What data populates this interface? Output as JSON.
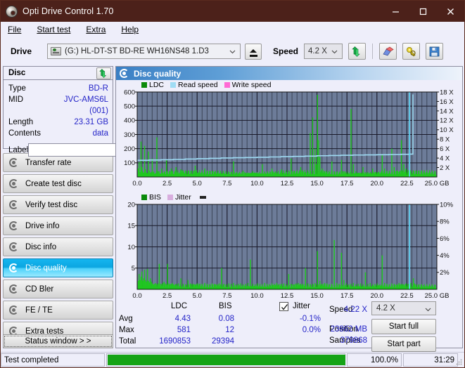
{
  "window": {
    "title": "Opti Drive Control 1.70",
    "icon": "disc-icon",
    "minimize": "minimize-icon",
    "maximize": "maximize-icon",
    "close": "close-icon"
  },
  "menu": {
    "items": [
      "File",
      "Start test",
      "Extra",
      "Help"
    ]
  },
  "toolbar": {
    "drive_label": "Drive",
    "drive_value": "(G:)  HL-DT-ST BD-RE  WH16NS48 1.D3",
    "eject": "eject-icon",
    "speed_label": "Speed",
    "speed_value": "4.2 X",
    "refresh": "refresh-icon",
    "erase": "eraser-icon",
    "key": "key-icon",
    "save": "save-icon"
  },
  "disc_panel": {
    "header": "Disc",
    "refresh_icon": "refresh-icon",
    "rows": [
      {
        "key": "Type",
        "value": "BD-R"
      },
      {
        "key": "MID",
        "value": "JVC-AMS6L (001)"
      },
      {
        "key": "Length",
        "value": "23.31 GB"
      },
      {
        "key": "Contents",
        "value": "data"
      }
    ],
    "label_key": "Label",
    "label_value": "",
    "label_placeholder": ""
  },
  "sidebar": {
    "items": [
      {
        "label": "Transfer rate",
        "selected": false
      },
      {
        "label": "Create test disc",
        "selected": false
      },
      {
        "label": "Verify test disc",
        "selected": false
      },
      {
        "label": "Drive info",
        "selected": false
      },
      {
        "label": "Disc info",
        "selected": false
      },
      {
        "label": "Disc quality",
        "selected": true
      },
      {
        "label": "CD Bler",
        "selected": false
      },
      {
        "label": "FE / TE",
        "selected": false
      },
      {
        "label": "Extra tests",
        "selected": false
      }
    ],
    "status_window": "Status window > >"
  },
  "content": {
    "title": "Disc quality",
    "title_icon": "disc-quality-icon"
  },
  "stats": {
    "col_ldc": "LDC",
    "col_bis": "BIS",
    "row_avg": "Avg",
    "row_max": "Max",
    "row_total": "Total",
    "ldc_avg": "4.43",
    "ldc_max": "581",
    "ldc_total": "1690853",
    "bis_avg": "0.08",
    "bis_max": "12",
    "bis_total": "29394",
    "jitter_label": "Jitter",
    "jitter_checked": true,
    "jitter_avg": "-0.1%",
    "jitter_max": "0.0%",
    "speed_label": "Speed",
    "speed_value": "4.22 X",
    "position_label": "Position",
    "position_value": "23862 MB",
    "samples_label": "Samples",
    "samples_value": "379868",
    "speed_select": "4.2 X",
    "start_full": "Start full",
    "start_part": "Start part"
  },
  "statusbar": {
    "message": "Test completed",
    "progress_percent": 100,
    "percent_text": "100.0%",
    "elapsed": "31:29"
  },
  "colors": {
    "ldc": "#1ec81e",
    "bis": "#1ec81e",
    "read_speed": "#9fdcf4",
    "write_speed": "#ff6ad5",
    "jitter": "#d8aede",
    "plot_bg": "#6d7c99",
    "grid": "#1a1a2a",
    "accent_blue": "#2424c8",
    "titlebar": "#4c211a",
    "progress": "#16a316"
  },
  "chart_data": [
    {
      "type": "bar",
      "name": "top-chart",
      "title": "",
      "xlabel": "25.0 GB",
      "ylabel": "",
      "y2label": "",
      "xlim": [
        0,
        25
      ],
      "ylim": [
        0,
        600
      ],
      "y2lim": [
        0,
        18
      ],
      "grid": true,
      "legend": [
        {
          "label": "LDC",
          "color": "#1ec81e"
        },
        {
          "label": "Read speed",
          "color": "#9fdcf4"
        },
        {
          "label": "Write speed",
          "color": "#ff6ad5"
        }
      ],
      "xticks": [
        "0.0",
        "2.5",
        "5.0",
        "7.5",
        "10.0",
        "12.5",
        "15.0",
        "17.5",
        "20.0",
        "22.5",
        "25.0 GB"
      ],
      "yticks": [
        "100",
        "200",
        "300",
        "400",
        "500",
        "600"
      ],
      "y2ticks": [
        "2 X",
        "4 X",
        "6 X",
        "8 X",
        "10 X",
        "12 X",
        "14 X",
        "16 X",
        "18 X"
      ],
      "series": [
        {
          "name": "LDC",
          "color": "#1ec81e",
          "kind": "bars",
          "x": [
            0.05,
            0.12,
            0.2,
            0.28,
            0.35,
            0.42,
            0.5,
            0.58,
            0.66,
            0.74,
            0.82,
            0.9,
            0.98,
            1.06,
            1.14,
            1.22,
            1.3,
            1.4,
            1.5,
            1.6,
            1.7,
            1.8,
            1.9,
            2.0,
            2.1,
            2.2,
            2.3,
            2.4,
            2.5,
            2.6,
            2.7,
            2.8,
            2.9,
            3.0,
            3.1,
            3.2,
            3.3,
            3.4,
            3.5,
            3.6,
            3.7,
            3.8,
            3.9,
            4.0,
            4.2,
            4.4,
            4.6,
            4.8,
            5.0,
            5.2,
            5.4,
            5.6,
            5.8,
            6.0,
            6.2,
            6.4,
            6.6,
            6.8,
            7.0,
            7.2,
            7.4,
            7.6,
            7.8,
            8.0,
            8.2,
            8.4,
            8.6,
            8.8,
            9.0,
            9.2,
            9.4,
            9.6,
            9.8,
            10.0,
            10.2,
            10.4,
            10.6,
            10.8,
            11.0,
            11.2,
            11.4,
            11.6,
            11.8,
            12.0,
            12.2,
            12.4,
            12.6,
            12.8,
            13.0,
            13.2,
            13.4,
            13.6,
            13.8,
            14.0,
            14.2,
            14.4,
            14.6,
            14.8,
            14.9,
            15.0,
            15.1,
            15.2,
            15.4,
            15.6,
            15.8,
            16.0,
            16.2,
            16.4,
            16.6,
            16.8,
            17.0,
            17.2,
            17.4,
            17.6,
            17.8,
            18.0,
            18.2,
            18.4,
            18.6,
            18.8,
            19.0,
            19.2,
            19.4,
            19.6,
            19.8,
            20.0,
            20.2,
            20.4,
            20.6,
            20.8,
            21.0,
            21.2,
            21.4,
            21.6,
            21.8,
            22.0,
            22.2,
            22.4,
            22.6,
            22.8,
            23.0,
            23.1
          ],
          "values": [
            60,
            105,
            35,
            250,
            70,
            40,
            30,
            220,
            55,
            30,
            25,
            180,
            45,
            28,
            20,
            130,
            35,
            22,
            20,
            280,
            40,
            25,
            22,
            60,
            30,
            24,
            20,
            120,
            30,
            22,
            20,
            60,
            28,
            20,
            18,
            70,
            30,
            22,
            20,
            55,
            45,
            30,
            26,
            40,
            28,
            25,
            22,
            80,
            28,
            22,
            20,
            60,
            28,
            22,
            20,
            35,
            26,
            22,
            20,
            30,
            25,
            22,
            20,
            110,
            30,
            25,
            22,
            45,
            28,
            24,
            20,
            40,
            30,
            25,
            22,
            90,
            35,
            28,
            25,
            60,
            30,
            26,
            22,
            55,
            30,
            26,
            22,
            130,
            35,
            28,
            25,
            70,
            40,
            30,
            28,
            310,
            420,
            200,
            90,
            580,
            260,
            140,
            60,
            40,
            35,
            30,
            110,
            40,
            30,
            26,
            120,
            40,
            30,
            26,
            480,
            90,
            40,
            30,
            26,
            70,
            35,
            30,
            26,
            60,
            35,
            28,
            26,
            160,
            60,
            40,
            30,
            200,
            70,
            45,
            35,
            260,
            90,
            60,
            45,
            30
          ]
        },
        {
          "name": "Read speed",
          "color": "#9fdcf4",
          "kind": "line",
          "axis": "right",
          "x": [
            0.0,
            1.0,
            2.0,
            3.0,
            4.0,
            5.0,
            6.0,
            7.0,
            8.0,
            9.0,
            10.0,
            11.0,
            12.0,
            13.0,
            14.0,
            15.0,
            16.0,
            17.0,
            18.0,
            19.0,
            20.0,
            21.0,
            22.0,
            22.7,
            23.0
          ],
          "values": [
            3.55,
            3.6,
            3.65,
            3.72,
            3.8,
            3.88,
            3.95,
            4.02,
            4.08,
            4.12,
            4.18,
            4.24,
            4.3,
            4.36,
            4.42,
            4.5,
            4.55,
            4.6,
            4.65,
            4.68,
            4.72,
            4.76,
            4.8,
            4.85,
            17.5
          ]
        },
        {
          "name": "Write speed",
          "color": "#ff6ad5",
          "kind": "line",
          "axis": "right",
          "x": [],
          "values": []
        }
      ]
    },
    {
      "type": "bar",
      "name": "bottom-chart",
      "title": "",
      "xlabel": "25.0 GB",
      "ylabel": "",
      "xlim": [
        0,
        25
      ],
      "ylim": [
        0,
        20
      ],
      "y2lim": [
        0,
        10
      ],
      "grid": true,
      "legend": [
        {
          "label": "BIS",
          "color": "#1ec81e"
        },
        {
          "label": "Jitter",
          "color": "#d8aede"
        }
      ],
      "xticks": [
        "0.0",
        "2.5",
        "5.0",
        "7.5",
        "10.0",
        "12.5",
        "15.0",
        "17.5",
        "20.0",
        "22.5",
        "25.0 GB"
      ],
      "yticks": [
        "5",
        "10",
        "15",
        "20"
      ],
      "y2ticks": [
        "2%",
        "4%",
        "6%",
        "8%",
        "10%"
      ],
      "series": [
        {
          "name": "BIS",
          "color": "#1ec81e",
          "kind": "bars",
          "x": [
            0.05,
            0.12,
            0.2,
            0.28,
            0.35,
            0.42,
            0.5,
            0.58,
            0.66,
            0.74,
            0.82,
            0.9,
            0.98,
            1.06,
            1.14,
            1.22,
            1.3,
            1.4,
            1.5,
            1.6,
            1.7,
            1.8,
            1.9,
            2.0,
            2.1,
            2.2,
            2.3,
            2.4,
            2.5,
            2.6,
            2.7,
            2.8,
            2.9,
            3.0,
            3.2,
            3.4,
            3.6,
            3.8,
            4.0,
            4.2,
            4.4,
            4.6,
            4.8,
            5.0,
            5.2,
            5.4,
            5.6,
            5.8,
            6.0,
            6.2,
            6.4,
            6.6,
            6.8,
            7.0,
            7.2,
            7.4,
            7.6,
            7.8,
            8.0,
            8.2,
            8.4,
            8.6,
            8.8,
            9.0,
            9.2,
            9.4,
            9.6,
            9.8,
            10.0,
            10.2,
            10.4,
            10.6,
            10.8,
            11.0,
            11.2,
            11.4,
            11.6,
            11.8,
            12.0,
            12.2,
            12.4,
            12.6,
            12.8,
            13.0,
            13.2,
            13.4,
            13.6,
            13.8,
            14.0,
            14.2,
            14.4,
            14.6,
            14.8,
            15.0,
            15.2,
            15.4,
            15.6,
            15.8,
            16.0,
            16.2,
            16.4,
            16.6,
            16.8,
            17.0,
            17.2,
            17.4,
            17.6,
            17.8,
            18.0,
            18.2,
            18.4,
            18.6,
            18.8,
            19.0,
            19.2,
            19.4,
            19.6,
            19.8,
            20.0,
            20.2,
            20.4,
            20.6,
            20.8,
            21.0,
            21.2,
            21.4,
            21.6,
            21.8,
            22.0,
            22.2,
            22.4,
            22.6,
            22.8,
            23.0,
            23.1
          ],
          "values": [
            2.0,
            3.6,
            2.2,
            3.0,
            4.2,
            2.0,
            2.6,
            4.6,
            2.2,
            1.8,
            4.8,
            2.0,
            1.6,
            2.6,
            1.8,
            1.4,
            1.2,
            1.3,
            1.5,
            1.2,
            1.4,
            6.0,
            1.3,
            1.2,
            1.5,
            1.8,
            1.4,
            1.2,
            6.0,
            1.4,
            1.2,
            1.3,
            1.5,
            1.2,
            1.3,
            1.4,
            2.6,
            1.3,
            1.2,
            2.2,
            1.4,
            1.3,
            1.2,
            1.4,
            1.3,
            1.2,
            1.5,
            1.3,
            1.2,
            1.4,
            1.3,
            1.2,
            1.4,
            5.0,
            1.3,
            1.2,
            1.4,
            1.3,
            1.5,
            1.2,
            1.3,
            1.4,
            1.2,
            1.3,
            1.5,
            7.0,
            1.3,
            1.2,
            1.4,
            1.3,
            1.2,
            1.5,
            1.3,
            1.2,
            1.4,
            1.3,
            1.5,
            1.2,
            1.3,
            1.4,
            1.2,
            3.6,
            1.3,
            1.2,
            1.4,
            1.5,
            1.3,
            1.2,
            5.0,
            1.4,
            1.2,
            1.3,
            1.5,
            9.0,
            2.0,
            1.3,
            1.5,
            1.4,
            1.2,
            1.3,
            11.6,
            1.5,
            1.3,
            8.6,
            2.2,
            1.4,
            1.2,
            1.3,
            1.5,
            1.2,
            1.3,
            1.4,
            1.2,
            4.0,
            1.3,
            1.5,
            1.2,
            1.3,
            1.4,
            1.2,
            8.0,
            1.5,
            1.3,
            1.2,
            1.4,
            1.3,
            1.2,
            1.5,
            1.3,
            1.2,
            1.4,
            1.3,
            1.5,
            2.6,
            1.4,
            1.2
          ]
        },
        {
          "name": "Jitter",
          "color": "#d8aede",
          "kind": "line",
          "axis": "right",
          "x": [],
          "values": []
        }
      ]
    }
  ]
}
